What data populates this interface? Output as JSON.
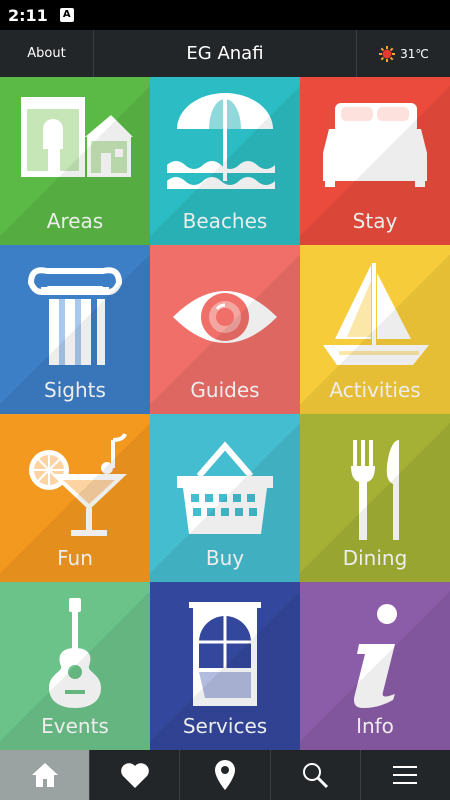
{
  "status_bar": {
    "time": "2:11",
    "notification_icon": "a-icon"
  },
  "header": {
    "about_label": "About",
    "title": "EG Anafi",
    "weather": {
      "icon": "sun-icon",
      "temperature": "31℃"
    }
  },
  "tiles": [
    {
      "label": "Areas",
      "icon": "houses-icon",
      "color": "#5bb946"
    },
    {
      "label": "Beaches",
      "icon": "umbrella-icon",
      "color": "#2bbdc3"
    },
    {
      "label": "Stay",
      "icon": "bed-icon",
      "color": "#ea4b3c"
    },
    {
      "label": "Sights",
      "icon": "column-icon",
      "color": "#3d7fc7"
    },
    {
      "label": "Guides",
      "icon": "eye-icon",
      "color": "#f06f68"
    },
    {
      "label": "Activities",
      "icon": "sailboat-icon",
      "color": "#f7cc3a"
    },
    {
      "label": "Fun",
      "icon": "cocktail-icon",
      "color": "#f4991f"
    },
    {
      "label": "Buy",
      "icon": "basket-icon",
      "color": "#45bdd0"
    },
    {
      "label": "Dining",
      "icon": "fork-knife-icon",
      "color": "#a4b134"
    },
    {
      "label": "Events",
      "icon": "guitar-icon",
      "color": "#6cc38a"
    },
    {
      "label": "Services",
      "icon": "window-icon",
      "color": "#33479c"
    },
    {
      "label": "Info",
      "icon": "info-icon",
      "color": "#8b5ca8"
    }
  ],
  "bottom_nav": [
    {
      "icon": "home-icon",
      "active": true
    },
    {
      "icon": "heart-icon",
      "active": false
    },
    {
      "icon": "map-pin-icon",
      "active": false
    },
    {
      "icon": "search-icon",
      "active": false
    },
    {
      "icon": "menu-icon",
      "active": false
    }
  ]
}
